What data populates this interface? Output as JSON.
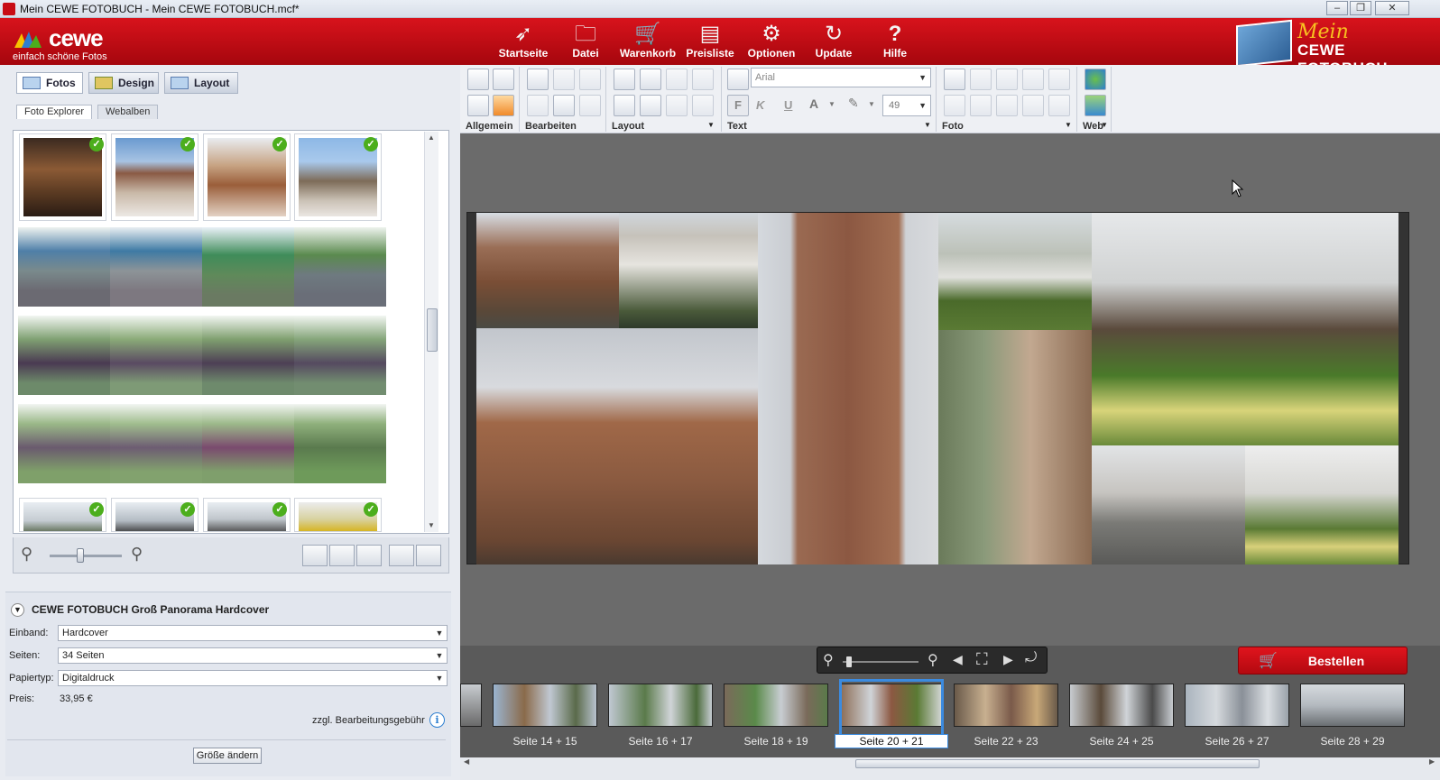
{
  "window": {
    "title": "Mein CEWE FOTOBUCH - Mein CEWE FOTOBUCH.mcf*",
    "controls": [
      "–",
      "❐",
      "✕"
    ]
  },
  "header": {
    "logo_brand": "cewe",
    "logo_tagline": "einfach schöne Fotos",
    "nav": [
      {
        "label": "Startseite",
        "icon": "home-icon"
      },
      {
        "label": "Datei",
        "icon": "file-icon"
      },
      {
        "label": "Warenkorb",
        "icon": "cart-icon"
      },
      {
        "label": "Preisliste",
        "icon": "price-list-icon"
      },
      {
        "label": "Optionen",
        "icon": "gear-icon"
      },
      {
        "label": "Update",
        "icon": "update-icon"
      },
      {
        "label": "Hilfe",
        "icon": "help-icon"
      }
    ],
    "brand_mein": "Mein",
    "brand_fotobuch": "CEWE FOTOBUCH",
    "accent": "#c80d15"
  },
  "left": {
    "tabs": [
      {
        "label": "Fotos",
        "active": true
      },
      {
        "label": "Design",
        "active": false
      },
      {
        "label": "Layout",
        "active": false
      }
    ],
    "subtabs": [
      {
        "label": "Foto Explorer",
        "active": true
      },
      {
        "label": "Webalben",
        "active": false
      }
    ],
    "check_mark": "✓"
  },
  "product": {
    "title": "CEWE FOTOBUCH Groß Panorama Hardcover",
    "einband_label": "Einband:",
    "einband_value": "Hardcover",
    "seiten_label": "Seiten:",
    "seiten_value": "34 Seiten",
    "papier_label": "Papiertyp:",
    "papier_value": "Digitaldruck",
    "preis_label": "Preis:",
    "preis_value": "33,95 €",
    "fee_note": "zzgl. Bearbeitungsgebühr",
    "resize_button": "Größe ändern"
  },
  "toolbar": {
    "groups": [
      "Allgemein",
      "Bearbeiten",
      "Layout",
      "Text",
      "Foto",
      "Web"
    ],
    "font_name": "Arial",
    "font_size": "49",
    "bold_label": "F",
    "italic_label": "K",
    "underline_label": "U",
    "textcolor_label": "A"
  },
  "bottom": {
    "order_button": "Bestellen",
    "pages": [
      {
        "label": "Seite 14 + 15",
        "active": false
      },
      {
        "label": "Seite 16 + 17",
        "active": false
      },
      {
        "label": "Seite 18 + 19",
        "active": false
      },
      {
        "label": "Seite 20 + 21",
        "active": true
      },
      {
        "label": "Seite 22 + 23",
        "active": false
      },
      {
        "label": "Seite 24 + 25",
        "active": false
      },
      {
        "label": "Seite 26 + 27",
        "active": false
      },
      {
        "label": "Seite 28 + 29",
        "active": false
      }
    ]
  }
}
